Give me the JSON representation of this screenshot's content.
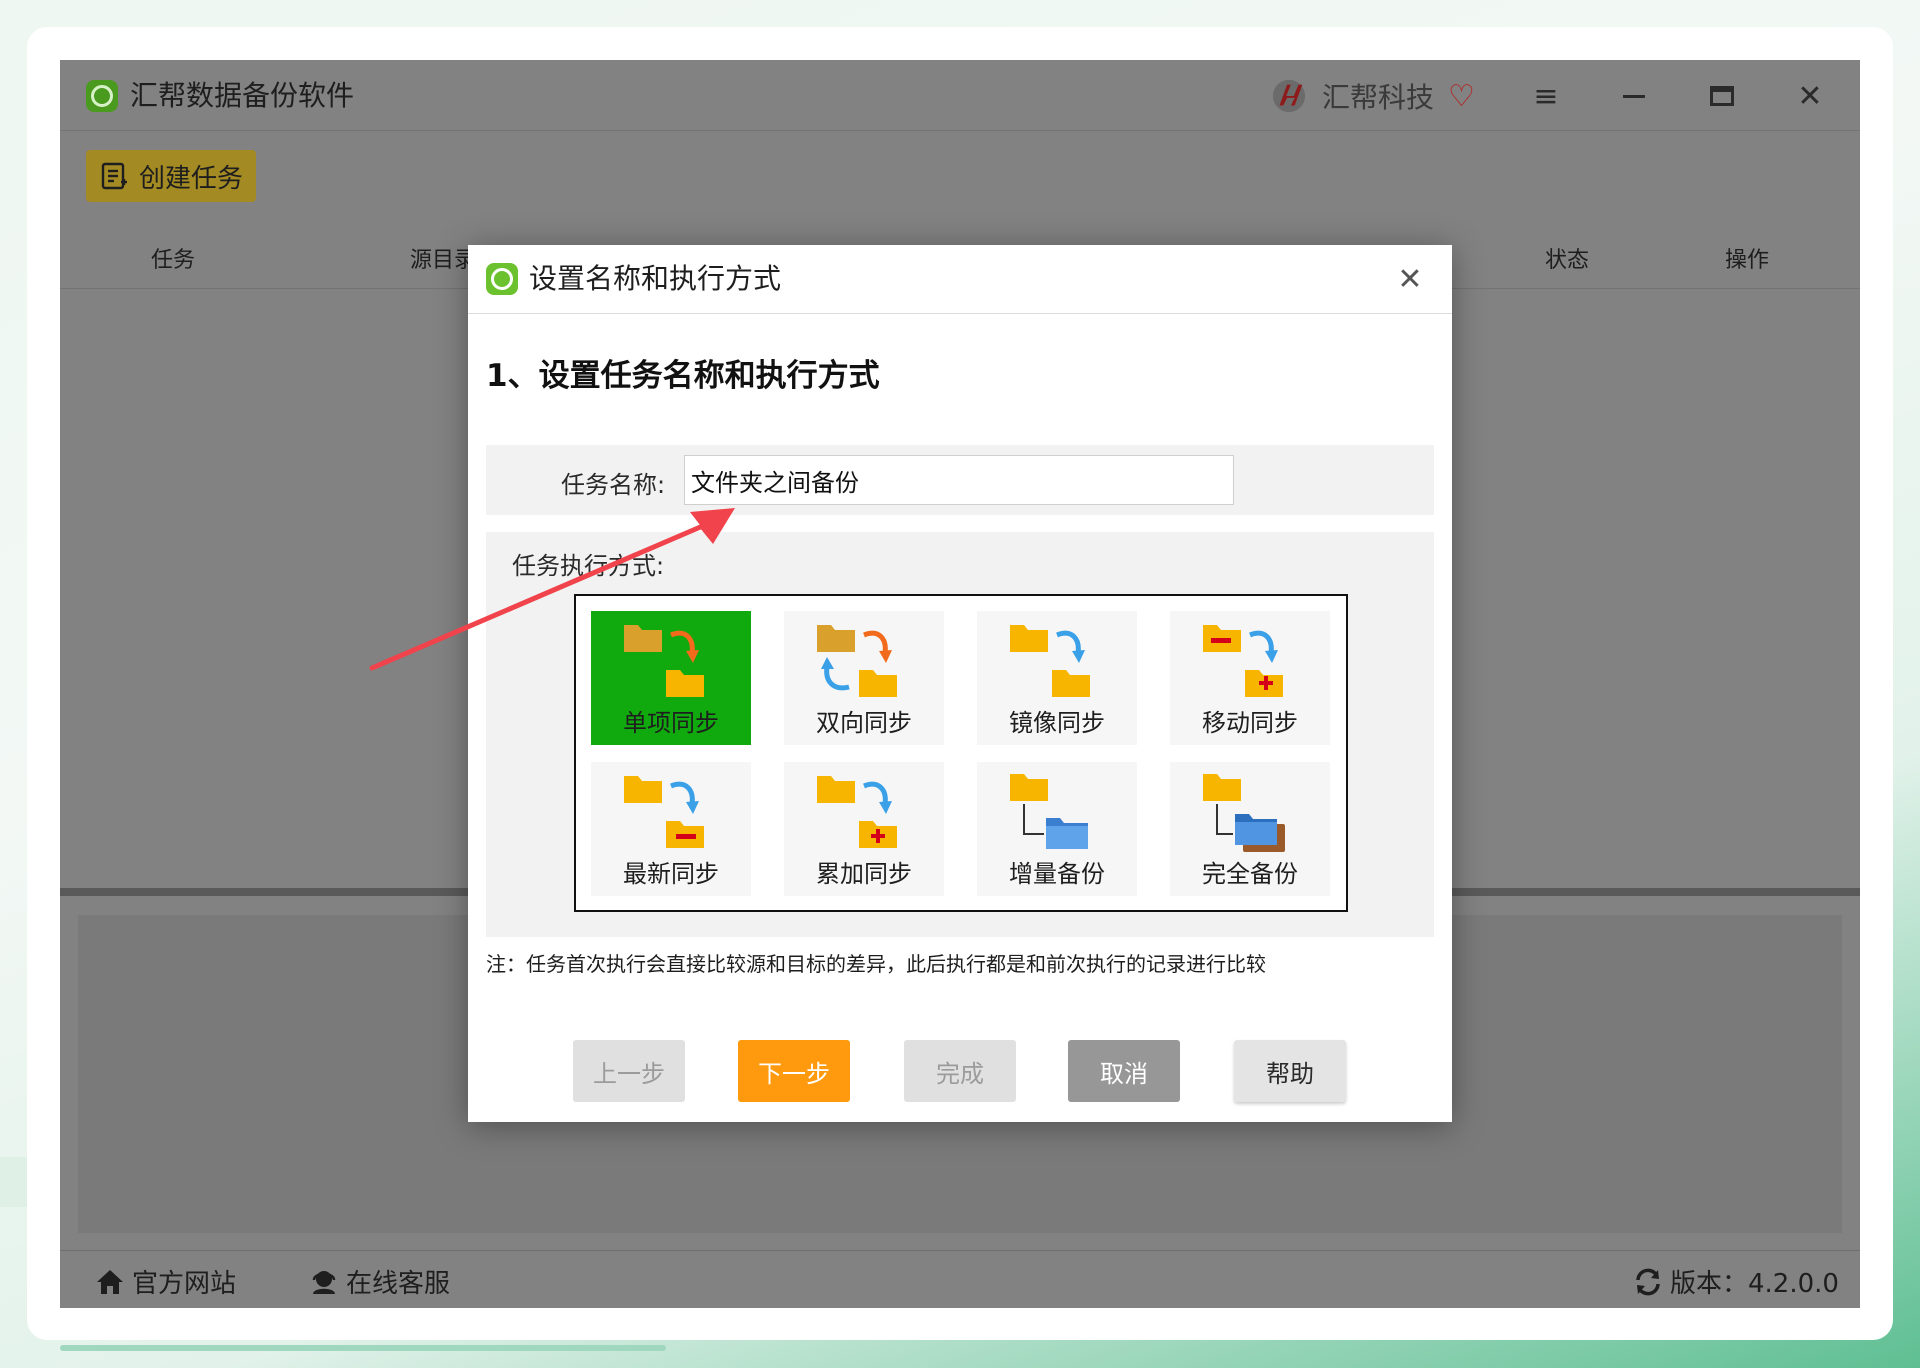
{
  "app": {
    "title": "汇帮数据备份软件",
    "brand_name": "汇帮科技",
    "create_task_label": "创建任务",
    "table_headers": {
      "task": "任务",
      "source": "源目录",
      "status": "状态",
      "operations": "操作"
    },
    "footer": {
      "official_site": "官方网站",
      "online_service": "在线客服",
      "version": "版本：4.2.0.0"
    }
  },
  "dialog": {
    "title": "设置名称和执行方式",
    "step_heading": "1、设置任务名称和执行方式",
    "task_name_label": "任务名称:",
    "task_name_value": "文件夹之间备份",
    "mode_label": "任务执行方式:",
    "modes": [
      {
        "label": "单项同步",
        "icon": "one-way-sync-icon",
        "selected": true
      },
      {
        "label": "双向同步",
        "icon": "two-way-sync-icon",
        "selected": false
      },
      {
        "label": "镜像同步",
        "icon": "mirror-sync-icon",
        "selected": false
      },
      {
        "label": "移动同步",
        "icon": "move-sync-icon",
        "selected": false
      },
      {
        "label": "最新同步",
        "icon": "latest-sync-icon",
        "selected": false
      },
      {
        "label": "累加同步",
        "icon": "cumulative-sync-icon",
        "selected": false
      },
      {
        "label": "增量备份",
        "icon": "incremental-backup-icon",
        "selected": false
      },
      {
        "label": "完全备份",
        "icon": "full-backup-icon",
        "selected": false
      }
    ],
    "note": "注：任务首次执行会直接比较源和目标的差异，此后执行都是和前次执行的记录进行比较",
    "buttons": {
      "prev": "上一步",
      "next": "下一步",
      "finish": "完成",
      "cancel": "取消",
      "help": "帮助"
    }
  },
  "colors": {
    "selected_tile": "#10a90e",
    "next_button": "#ff9a0e",
    "annotation_arrow": "#f0434b",
    "folder": "#f7b500"
  }
}
